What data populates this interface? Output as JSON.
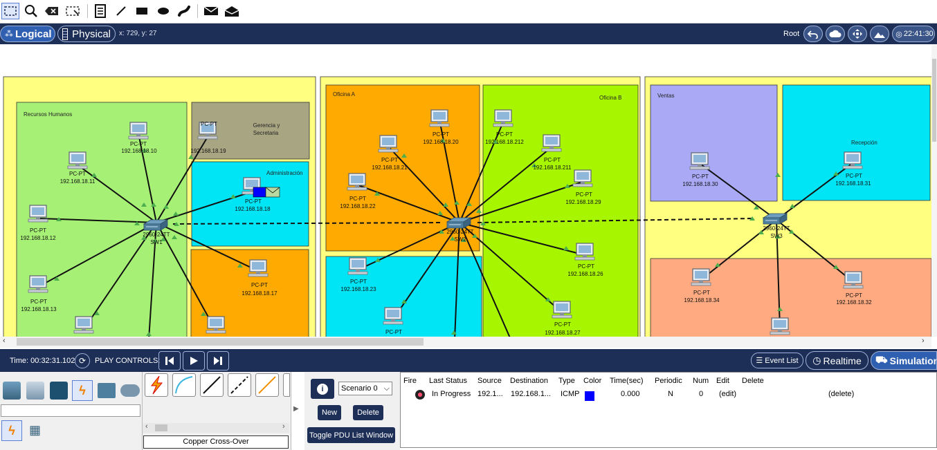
{
  "toolbar": {
    "icons": [
      "select-icon",
      "zoom-icon",
      "delete-icon",
      "resize-icon",
      "note-icon",
      "line-icon",
      "rectangle-icon",
      "ellipse-icon",
      "freeform-icon",
      "add-simple-pdu-icon",
      "add-complex-pdu-icon"
    ]
  },
  "nav": {
    "logical_label": "Logical",
    "physical_label": "Physical",
    "coords": "x: 729, y: 27",
    "root_label": "Root",
    "clock": "22:41:30"
  },
  "zones": {
    "recursos_humanos": "Recursos Humanos",
    "gerencia_l1": "Gerencia y",
    "gerencia_l2": "Secretaria",
    "administracion": "Administración",
    "oficina_a": "Oficina A",
    "oficina_b": "Oficina B",
    "ventas": "Ventas",
    "recepcion": "Recepción"
  },
  "switches": [
    {
      "model": "2960-24TT",
      "name": "SW1"
    },
    {
      "model": "2960-24TT",
      "name": "SW2"
    },
    {
      "model": "2960-24TT",
      "name": "SW3"
    }
  ],
  "pcs": {
    "type": "PC-PT",
    "ips": {
      "p10": "192.168.18.10",
      "p19": "192.168.18.19",
      "p11": "192.168.18.11",
      "p18": "192.168.18.18",
      "p12": "192.168.18.12",
      "p17": "192.168.18.17",
      "p13": "192.168.18.13",
      "p20": "192.168.18.20",
      "p212": "192.168.18.212",
      "p21": "192.168.18.21",
      "p211": "192.168.18.211",
      "p22": "192.168.18.22",
      "p29": "192.168.18.29",
      "p26": "192.168.18.26",
      "p23": "192.168.18.23",
      "p27": "192.168.18.27",
      "p30": "192.168.18.30",
      "p31": "192.168.18.31",
      "p34": "192.168.18.34",
      "p32": "192.168.18.32"
    }
  },
  "sim": {
    "time": "Time: 00:32:31.102",
    "play_controls": "PLAY CONTROLS:",
    "event_list": "Event List",
    "realtime": "Realtime",
    "simulation": "Simulation"
  },
  "bottom": {
    "search_value": "",
    "connection_label": "Copper Cross-Over",
    "scenario": "Scenario 0",
    "new_label": "New",
    "delete_label": "Delete",
    "toggle_label": "Toggle PDU List Window",
    "headers": [
      "Fire",
      "Last Status",
      "Source",
      "Destination",
      "Type",
      "Color",
      "Time(sec)",
      "Periodic",
      "Num",
      "Edit",
      "Delete"
    ],
    "row": {
      "last_status": "In Progress",
      "source": "192.1...",
      "destination": "192.168.1...",
      "type": "ICMP",
      "color": "#0000ff",
      "time": "0.000",
      "periodic": "N",
      "num": "0",
      "edit": "(edit)",
      "delete": "(delete)"
    }
  },
  "colors": {
    "nav_bg": "#1d2f57",
    "yellow_zone": "#ffff80",
    "green_zone": "#a6f075",
    "cyan_zone": "#00e5f5",
    "orange_zone": "#ffaa00",
    "lime_zone": "#a8f500",
    "purple_zone": "#a9a9f5",
    "salmon_zone": "#ffaa80",
    "olive_zone": "#a8a582"
  }
}
